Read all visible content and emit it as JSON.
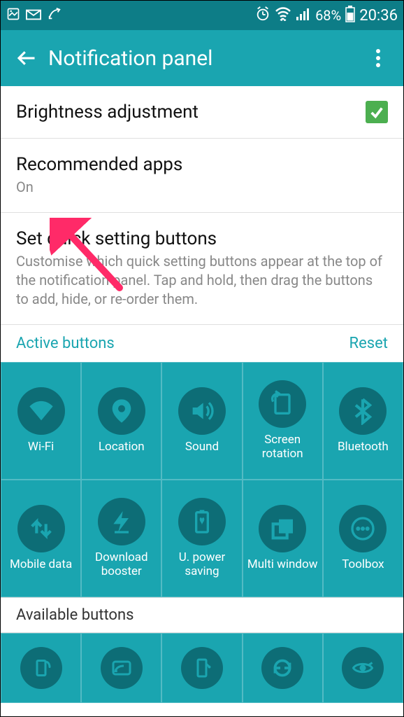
{
  "status": {
    "battery_pct": "68%",
    "time": "20:36"
  },
  "appbar": {
    "title": "Notification panel"
  },
  "rows": {
    "brightness": {
      "title": "Brightness adjustment",
      "checked": true
    },
    "recommended": {
      "title": "Recommended apps",
      "sub": "On"
    },
    "quickset": {
      "title": "Set quick setting buttons",
      "sub": "Customise which quick setting buttons appear at the top of the notification panel. Tap and hold, then drag the buttons to add, hide, or re-order them."
    }
  },
  "active_section": {
    "label": "Active buttons",
    "reset": "Reset"
  },
  "active_buttons": [
    {
      "id": "wifi",
      "label": "Wi-Fi"
    },
    {
      "id": "location",
      "label": "Location"
    },
    {
      "id": "sound",
      "label": "Sound"
    },
    {
      "id": "rotation",
      "label": "Screen rotation"
    },
    {
      "id": "bluetooth",
      "label": "Bluetooth"
    },
    {
      "id": "mdata",
      "label": "Mobile data"
    },
    {
      "id": "dlboost",
      "label": "Download booster"
    },
    {
      "id": "upower",
      "label": "U. power saving"
    },
    {
      "id": "multiwin",
      "label": "Multi window"
    },
    {
      "id": "toolbox",
      "label": "Toolbox"
    }
  ],
  "available_section": {
    "label": "Available buttons"
  },
  "available_buttons": [
    {
      "id": "hotspot",
      "label": ""
    },
    {
      "id": "mirroring",
      "label": ""
    },
    {
      "id": "nfc",
      "label": ""
    },
    {
      "id": "sync",
      "label": ""
    },
    {
      "id": "smartstay",
      "label": ""
    }
  ],
  "annotation": {
    "color": "#ff2a68"
  }
}
